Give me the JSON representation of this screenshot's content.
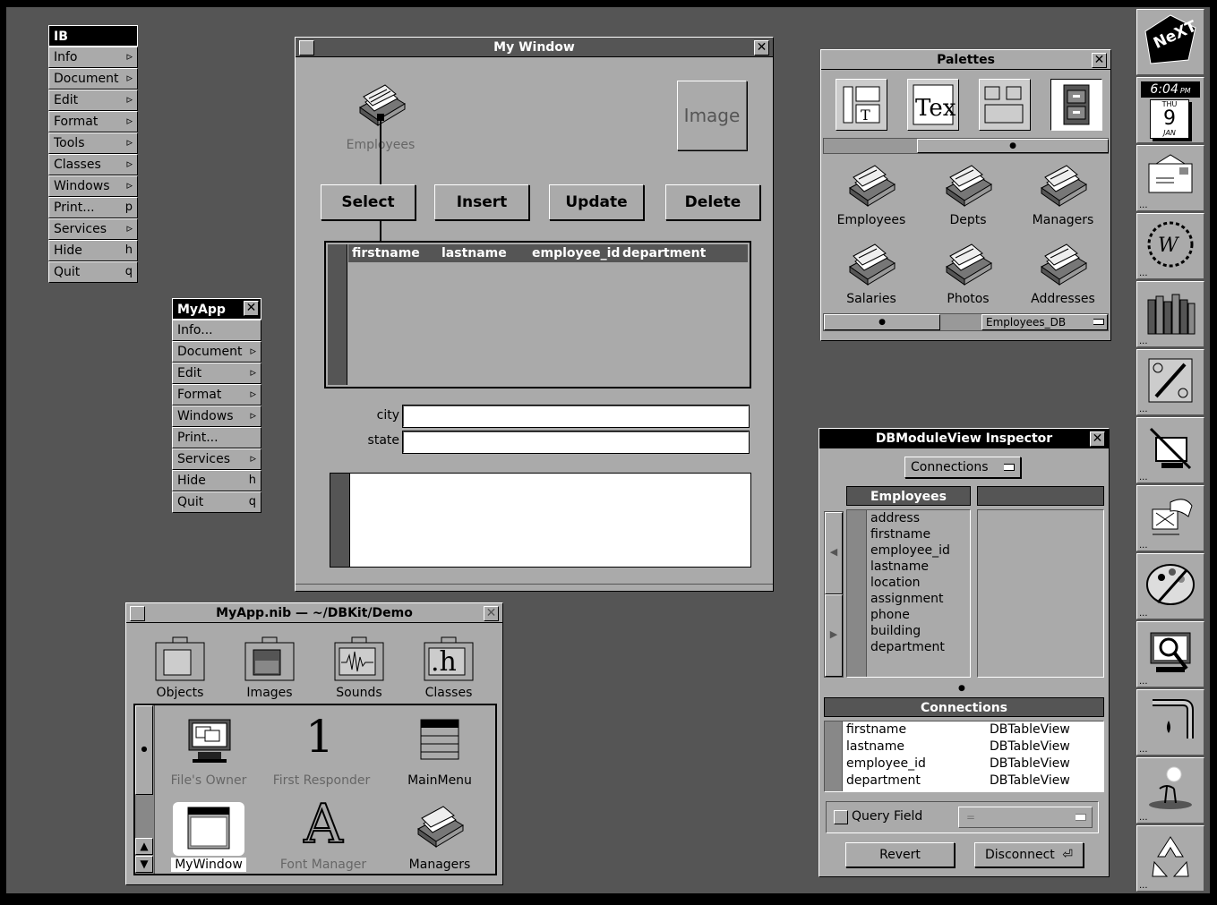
{
  "ib_menu": {
    "title": "IB",
    "items": [
      {
        "label": "Info",
        "key": "▹"
      },
      {
        "label": "Document",
        "key": "▹"
      },
      {
        "label": "Edit",
        "key": "▹"
      },
      {
        "label": "Format",
        "key": "▹"
      },
      {
        "label": "Tools",
        "key": "▹"
      },
      {
        "label": "Classes",
        "key": "▹"
      },
      {
        "label": "Windows",
        "key": "▹"
      },
      {
        "label": "Print...",
        "key": "p"
      },
      {
        "label": "Services",
        "key": "▹"
      },
      {
        "label": "Hide",
        "key": "h"
      },
      {
        "label": "Quit",
        "key": "q"
      }
    ]
  },
  "myapp_menu": {
    "title": "MyApp",
    "items": [
      {
        "label": "Info...",
        "key": ""
      },
      {
        "label": "Document",
        "key": "▹"
      },
      {
        "label": "Edit",
        "key": "▹"
      },
      {
        "label": "Format",
        "key": "▹"
      },
      {
        "label": "Windows",
        "key": "▹"
      },
      {
        "label": "Print...",
        "key": ""
      },
      {
        "label": "Services",
        "key": "▹"
      },
      {
        "label": "Hide",
        "key": "h"
      },
      {
        "label": "Quit",
        "key": "q"
      }
    ]
  },
  "my_window": {
    "title": "My Window",
    "icon_label": "Employees",
    "image_label": "Image",
    "buttons": {
      "select": "Select",
      "insert": "Insert",
      "update": "Update",
      "delete": "Delete"
    },
    "table_columns": [
      "firstname",
      "lastname",
      "employee_id",
      "department"
    ],
    "city_label": "city",
    "state_label": "state",
    "city_value": "",
    "state_value": ""
  },
  "palettes": {
    "title": "Palettes",
    "items": [
      "Employees",
      "Depts",
      "Managers",
      "Salaries",
      "Photos",
      "Addresses"
    ],
    "popup": "Employees_DB"
  },
  "inspector": {
    "title": "DBModuleView Inspector",
    "mode_popup": "Connections",
    "column_header": "Employees",
    "attributes": [
      "address",
      "firstname",
      "employee_id",
      "lastname",
      "location",
      "assignment",
      "phone",
      "building",
      "department"
    ],
    "connections_header": "Connections",
    "connections": [
      {
        "field": "firstname",
        "target": "DBTableView"
      },
      {
        "field": "lastname",
        "target": "DBTableView"
      },
      {
        "field": "employee_id",
        "target": "DBTableView"
      },
      {
        "field": "department",
        "target": "DBTableView"
      }
    ],
    "query_field_label": "Query Field",
    "query_popup": "=",
    "revert": "Revert",
    "disconnect": "Disconnect"
  },
  "nib_window": {
    "title": "MyApp.nib  —  ~/DBKit/Demo",
    "tabs": [
      "Objects",
      "Images",
      "Sounds",
      "Classes"
    ],
    "objects": [
      "File's Owner",
      "First Responder",
      "MainMenu",
      "MyWindow",
      "Font Manager",
      "Managers"
    ],
    "first_responder_glyph": "1",
    "font_manager_glyph": "A",
    "classes_glyph": ".h"
  },
  "dock": {
    "clock_time": "6:04",
    "clock_ampm": "PM",
    "clock_day": "THU",
    "clock_date": "9",
    "clock_month": "JAN",
    "next_logo": "NeXT"
  },
  "colors": {
    "desktop": "#555555",
    "window": "#aaaaaa",
    "dark": "#000000",
    "white": "#ffffff"
  }
}
